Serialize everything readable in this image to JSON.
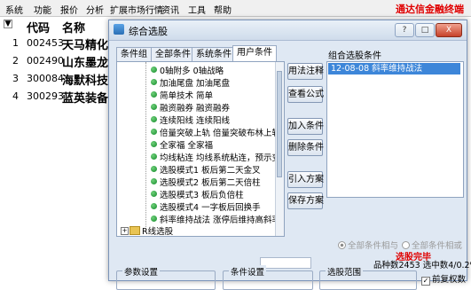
{
  "menu": [
    "系统",
    "功能",
    "报价",
    "分析",
    "扩展市场行情",
    "资讯",
    "工具",
    "帮助"
  ],
  "promo": "通达信金融终端",
  "stock_list": {
    "columns": [
      "代码",
      "名称"
    ],
    "rows": [
      {
        "num": "1",
        "code": "002453",
        "name": "天马精化"
      },
      {
        "num": "2",
        "code": "002490",
        "name": "山东墨龙"
      },
      {
        "num": "3",
        "code": "300084",
        "name": "海默科技"
      },
      {
        "num": "4",
        "code": "300293",
        "name": "蓝英装备"
      }
    ]
  },
  "dialog": {
    "title": "综合选股",
    "window_buttons": [
      "?",
      "□",
      "X"
    ],
    "tabs": [
      "条件组",
      "全部条件",
      "系统条件",
      "用户条件"
    ],
    "active_tab": "用户条件",
    "tree_items": [
      "0轴附多 0轴战略",
      "加油尾盘 加油尾盘",
      "简单技术 简单",
      "融资融券 融资融券",
      "连续阳线 连续阳线",
      "倍量突破上轨 倍量突破布林上轨",
      "全家福 全家福",
      "均线粘连 均线系统粘连，预示变盘",
      "选股模式1 板后第二天金叉",
      "选股模式2 板后第二天倍柱",
      "选股模式3 板后负倍柱",
      "选股模式4 一字板后回换手",
      "斜率维持战法 涨停后维持高斜率战法"
    ],
    "tree_root": "R线选股",
    "buttons": {
      "explain": "用法注释",
      "formula": "查看公式",
      "add": "加入条件",
      "delete": "删除条件",
      "import": "引入方案",
      "save": "保存方案"
    },
    "selected_label": "组合选股条件",
    "selected_items": [
      "12-08-08 斜率维持战法"
    ],
    "radio_and": "全部条件相与",
    "radio_or": "全部条件相或",
    "status": "选股完毕",
    "count_text": "品种数2453 选中数4/0.2%",
    "groups": [
      "参数设置",
      "条件设置",
      "选股范围"
    ],
    "option_label": "前复权数"
  }
}
